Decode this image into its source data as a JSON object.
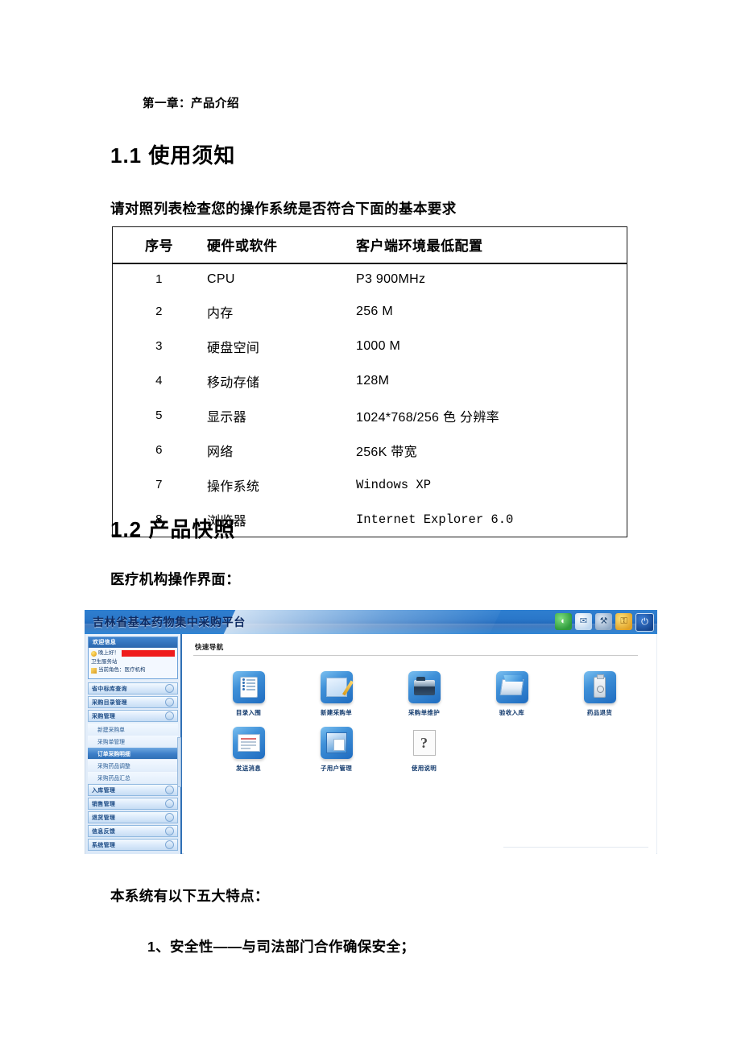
{
  "document": {
    "chapter": "第一章：产品介绍",
    "section_1_1_title": "1.1 使用须知",
    "intro_paragraph": "请对照列表检查您的操作系统是否符合下面的基本要求",
    "section_1_2_title": "1.2 产品快照",
    "screenshot_caption": "医疗机构操作界面：",
    "features_lead": "本系统有以下五大特点：",
    "feature_items": [
      "1、安全性——与司法部门合作确保安全；"
    ]
  },
  "spec_table": {
    "headers": [
      "序号",
      "硬件或软件",
      "客户端环境最低配置"
    ],
    "rows": [
      {
        "index": "1",
        "item": "CPU",
        "value": "P3  900MHz",
        "mono": false
      },
      {
        "index": "2",
        "item": "内存",
        "value": "256 M",
        "mono": false
      },
      {
        "index": "3",
        "item": "硬盘空间",
        "value": "1000 M",
        "mono": false
      },
      {
        "index": "4",
        "item": "移动存储",
        "value": "128M",
        "mono": false
      },
      {
        "index": "5",
        "item": "显示器",
        "value": "1024*768/256 色  分辨率",
        "mono": false
      },
      {
        "index": "6",
        "item": "网络",
        "value": "256K 带宽",
        "mono": false
      },
      {
        "index": "7",
        "item": "操作系统",
        "value": "Windows XP",
        "mono": true
      },
      {
        "index": "8",
        "item": "浏览器",
        "value": "Internet Explorer 6.0",
        "mono": true
      }
    ]
  },
  "app_screenshot": {
    "banner_title": "吉林省基本药物集中采购平台",
    "toolbar_icons": [
      {
        "name": "globe-icon",
        "glyph": "◐"
      },
      {
        "name": "mail-icon",
        "glyph": "✉"
      },
      {
        "name": "tools-icon",
        "glyph": "⚒"
      },
      {
        "name": "key-icon",
        "glyph": "⚿"
      },
      {
        "name": "power-icon",
        "glyph": "⏻"
      }
    ],
    "sidebar": {
      "welcome_header": "欢迎信息",
      "greeting": "晚上好！",
      "org_line": "卫生服务站",
      "role_line": "当前角色：医疗机构",
      "groups": [
        {
          "label": "省中标库查询",
          "children": []
        },
        {
          "label": "采购目录管理",
          "children": []
        },
        {
          "label": "采购管理",
          "children": [
            {
              "label": "新建采购单",
              "active": false
            },
            {
              "label": "采购单管理",
              "active": false
            },
            {
              "label": "订单采购明细",
              "active": true
            },
            {
              "label": "采购药品调整",
              "active": false
            },
            {
              "label": "采购药品汇总",
              "active": false
            }
          ]
        },
        {
          "label": "入库管理",
          "children": []
        },
        {
          "label": "销售管理",
          "children": []
        },
        {
          "label": "退货管理",
          "children": []
        },
        {
          "label": "信息反馈",
          "children": []
        },
        {
          "label": "系统管理",
          "children": []
        }
      ]
    },
    "content": {
      "nav_title": "快速导航",
      "shortcuts_row1": [
        {
          "label": "目录入围",
          "icon": "catalog-icon"
        },
        {
          "label": "新建采购单",
          "icon": "new-order-icon"
        },
        {
          "label": "采购单维护",
          "icon": "order-maintain-icon"
        },
        {
          "label": "验收入库",
          "icon": "receive-stock-icon"
        },
        {
          "label": "药品退货",
          "icon": "drug-return-icon"
        }
      ],
      "shortcuts_row2": [
        {
          "label": "发送消息",
          "icon": "send-message-icon"
        },
        {
          "label": "子用户管理",
          "icon": "sub-user-icon"
        },
        {
          "label": "使用说明",
          "icon": "help-icon",
          "glyph": "?"
        }
      ]
    }
  },
  "colors": {
    "banner_blue": "#2a77c9",
    "sidebar_border": "#2f6fb5",
    "active_item": "#3d7fc8",
    "redaction_red": "#ef1c1c",
    "label_blue": "#123a6d"
  }
}
